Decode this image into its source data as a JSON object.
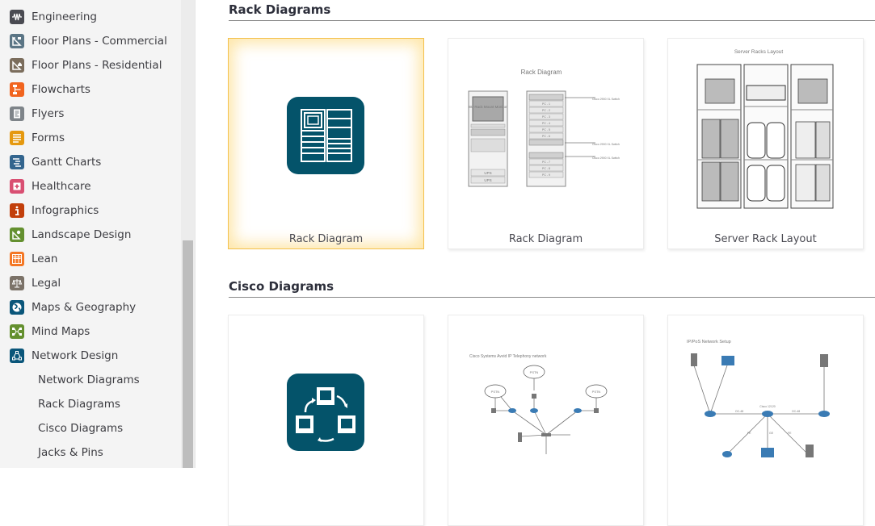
{
  "sidebar": {
    "items": [
      {
        "label": "Engineering",
        "icon": "engineering-icon",
        "color": "#4a4b52"
      },
      {
        "label": "Floor Plans - Commercial",
        "icon": "floor-plan-commercial-icon",
        "color": "#5b7585"
      },
      {
        "label": "Floor Plans - Residential",
        "icon": "floor-plan-residential-icon",
        "color": "#7b6d5c"
      },
      {
        "label": "Flowcharts",
        "icon": "flowchart-icon",
        "color": "#f1641e"
      },
      {
        "label": "Flyers",
        "icon": "flyer-icon",
        "color": "#7e8489"
      },
      {
        "label": "Forms",
        "icon": "form-icon",
        "color": "#e5990f"
      },
      {
        "label": "Gantt Charts",
        "icon": "gantt-icon",
        "color": "#33658e"
      },
      {
        "label": "Healthcare",
        "icon": "healthcare-icon",
        "color": "#d94f72"
      },
      {
        "label": "Infographics",
        "icon": "info-icon",
        "color": "#c23f0b"
      },
      {
        "label": "Landscape Design",
        "icon": "landscape-icon",
        "color": "#64902f"
      },
      {
        "label": "Lean",
        "icon": "lean-icon",
        "color": "#f47724"
      },
      {
        "label": "Legal",
        "icon": "scales-icon",
        "color": "#7b7268"
      },
      {
        "label": "Maps & Geography",
        "icon": "globe-icon",
        "color": "#0a567a"
      },
      {
        "label": "Mind Maps",
        "icon": "mind-map-icon",
        "color": "#64902f"
      },
      {
        "label": "Network Design",
        "icon": "network-icon",
        "color": "#0a567a"
      }
    ],
    "subitems": [
      {
        "label": "Network Diagrams"
      },
      {
        "label": "Rack Diagrams"
      },
      {
        "label": "Cisco Diagrams"
      },
      {
        "label": "Jacks & Pins"
      }
    ]
  },
  "sections": [
    {
      "title": "Rack Diagrams",
      "cards": [
        {
          "label": "Rack Diagram",
          "selected": true,
          "kind": "blank-template"
        },
        {
          "label": "Rack Diagram",
          "kind": "example",
          "preview_title": "Rack Diagram",
          "left_rack": [
            "8U Rack Mount Monitor",
            "UPS",
            "UPS"
          ],
          "right_rack": [
            "PC - 1",
            "PC - 2",
            "PC - 3",
            "PC - 4",
            "PC - 5",
            "PC - 6",
            "PC - 7",
            "PC - 8",
            "PC - 9"
          ],
          "switch_label": "Cisco 2900 XL Switch"
        },
        {
          "label": "Server Rack Layout",
          "kind": "example",
          "preview_title": "Server Racks Layout"
        }
      ]
    },
    {
      "title": "Cisco Diagrams",
      "cards": [
        {
          "label": "",
          "kind": "blank-template"
        },
        {
          "label": "",
          "kind": "example",
          "preview_title": "Cisco Systems Avvid IP Telephony network",
          "cloud_label": "PSTN"
        },
        {
          "label": "",
          "kind": "example",
          "preview_title": "IP/PoS Network Setup",
          "center_label": "Cisco 12120",
          "link_labels": [
            "OC-48",
            "OC-48",
            "GE",
            "FE",
            "FE"
          ]
        }
      ]
    }
  ],
  "colors": {
    "accent": "#04536a",
    "selected_border": "#f3c04a"
  }
}
